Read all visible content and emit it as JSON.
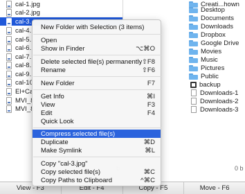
{
  "left_pane": {
    "files": [
      {
        "name": "cal-1.jpg",
        "selected": false
      },
      {
        "name": "cal-2.jpg",
        "selected": false
      },
      {
        "name": "cal-3.",
        "selected": true
      },
      {
        "name": "cal-4.",
        "selected": false
      },
      {
        "name": "cal-5.",
        "selected": false
      },
      {
        "name": "cal-6.",
        "selected": false
      },
      {
        "name": "cal-7.",
        "selected": false
      },
      {
        "name": "cal-8.",
        "selected": false
      },
      {
        "name": "cal-9.",
        "selected": false
      },
      {
        "name": "cal-10",
        "selected": false
      },
      {
        "name": "El+Ca",
        "selected": false
      },
      {
        "name": "MVI_8",
        "selected": false
      },
      {
        "name": "MVI_8",
        "selected": false
      }
    ],
    "size_label": "b"
  },
  "right_pane": {
    "items": [
      {
        "name": "Creati...hown",
        "kind": "folder"
      },
      {
        "name": "Desktop",
        "kind": "folder"
      },
      {
        "name": "Documents",
        "kind": "folder"
      },
      {
        "name": "Downloads",
        "kind": "folder"
      },
      {
        "name": "Dropbox",
        "kind": "folder"
      },
      {
        "name": "Google Drive",
        "kind": "folder"
      },
      {
        "name": "Movies",
        "kind": "folder"
      },
      {
        "name": "Music",
        "kind": "folder"
      },
      {
        "name": "Pictures",
        "kind": "folder"
      },
      {
        "name": "Public",
        "kind": "folder"
      },
      {
        "name": "backup",
        "kind": "alias"
      },
      {
        "name": "Downloads-1",
        "kind": "file"
      },
      {
        "name": "Downloads-2",
        "kind": "file"
      },
      {
        "name": "Downloads-3",
        "kind": "file"
      }
    ],
    "size_label": "0 b"
  },
  "context_menu": {
    "items": [
      {
        "label": "New Folder with Selection (3 items)",
        "shortcut": ""
      },
      {
        "label": "Open",
        "shortcut": ""
      },
      {
        "label": "Show in Finder",
        "shortcut": "⌥⌘O"
      },
      {
        "label": "Delete selected file(s) permanently",
        "shortcut": "⇧F8"
      },
      {
        "label": "Rename",
        "shortcut": "⇧F6"
      },
      {
        "label": "New Folder",
        "shortcut": "F7"
      },
      {
        "label": "Get Info",
        "shortcut": "⌘I"
      },
      {
        "label": "View",
        "shortcut": "F3"
      },
      {
        "label": "Edit",
        "shortcut": "F4"
      },
      {
        "label": "Quick Look",
        "shortcut": ""
      },
      {
        "label": "Compress selected file(s)",
        "shortcut": "",
        "highlighted": true
      },
      {
        "label": "Duplicate",
        "shortcut": "⌘D"
      },
      {
        "label": "Make Symlink",
        "shortcut": "⌘L"
      },
      {
        "label": "Copy \"cal-3.jpg\"",
        "shortcut": ""
      },
      {
        "label": "Copy selected file(s)",
        "shortcut": "⌘C"
      },
      {
        "label": "Copy Paths to Clipboard",
        "shortcut": "^⌘C"
      }
    ]
  },
  "fkeys": [
    {
      "label": "View - F3"
    },
    {
      "label": "Edit - F4"
    },
    {
      "label": "Copy - F5"
    },
    {
      "label": "Move - F6"
    }
  ],
  "colors": {
    "selection": "#1f58d9",
    "menu_highlight": "#2b63dd",
    "folder": "#6fb4ee"
  }
}
